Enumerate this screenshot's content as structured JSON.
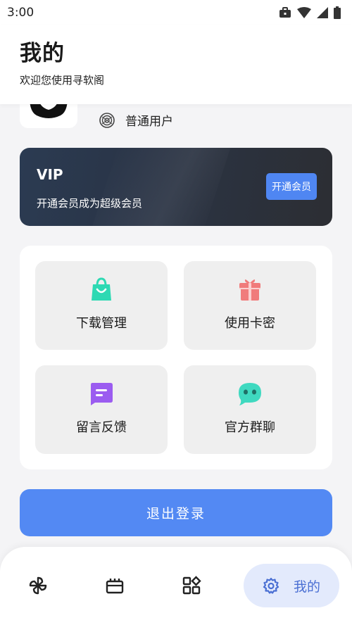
{
  "status_bar": {
    "time": "3:00"
  },
  "header": {
    "title": "我的",
    "subtitle": "欢迎您使用寻软阁"
  },
  "profile": {
    "user_type": "普通用户"
  },
  "vip": {
    "title": "VIP",
    "description": "开通会员成为超级会员",
    "button_label": "开通会员"
  },
  "menu": {
    "items": [
      {
        "label": "下载管理",
        "icon": "shopping-bag-icon",
        "color": "#2ed9b3"
      },
      {
        "label": "使用卡密",
        "icon": "gift-icon",
        "color": "#f07b7b"
      },
      {
        "label": "留言反馈",
        "icon": "message-icon",
        "color": "#9b5cf0"
      },
      {
        "label": "官方群聊",
        "icon": "chat-bubble-icon",
        "color": "#3fd9c0"
      }
    ]
  },
  "logout": {
    "label": "退出登录"
  },
  "bottom_nav": {
    "items": [
      {
        "icon": "pinwheel-icon"
      },
      {
        "icon": "ticket-icon"
      },
      {
        "icon": "apps-grid-icon"
      },
      {
        "icon": "gear-icon",
        "label": "我的",
        "active": true
      }
    ]
  },
  "colors": {
    "accent": "#5389f3",
    "vip_card": "#2a3446",
    "active_nav_bg": "#e3eafc"
  }
}
